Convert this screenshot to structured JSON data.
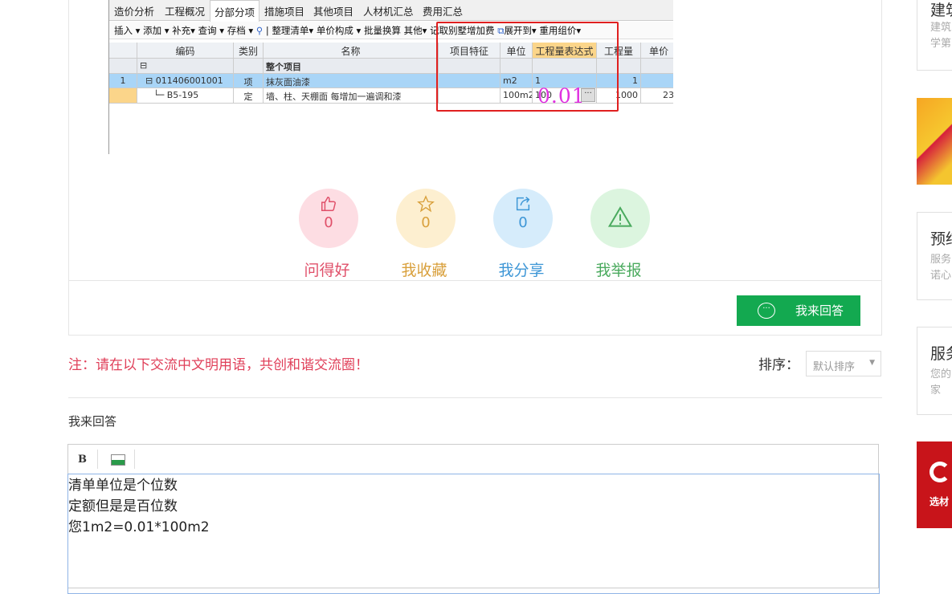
{
  "screenshot": {
    "tabs": [
      "造价分析",
      "工程概况",
      "分部分项",
      "措施项目",
      "其他项目",
      "人材机汇总",
      "费用汇总"
    ],
    "active_tab": "分部分项",
    "toolbar": [
      "插入 ▾",
      "添加 ▾",
      "补充▾",
      "查询 ▾",
      "存档 ▾",
      "整理清单▾",
      "单价构成 ▾",
      "批量换算",
      "其他▾",
      "记取别墅增加费",
      "展开到▾",
      "重用组价▾"
    ],
    "columns": [
      "编码",
      "类别",
      "名称",
      "项目特征",
      "单位",
      "工程量表达式",
      "工程量",
      "单价"
    ],
    "rows": [
      {
        "num": "",
        "code": "",
        "type": "",
        "name": "整个项目",
        "feature": "",
        "unit": "",
        "expr": "",
        "qty": "",
        "price": ""
      },
      {
        "num": "1",
        "code": "011406001001",
        "type": "项",
        "name": "抹灰面油漆",
        "feature": "",
        "unit": "m2",
        "expr": "1",
        "qty": "1",
        "price": ""
      },
      {
        "num": "",
        "code": "B5-195",
        "type": "定",
        "name": "墙、柱、天棚面 每增加一遍调和漆",
        "feature": "",
        "unit": "100m2",
        "expr": "100",
        "qty": "1000",
        "price": "23"
      }
    ],
    "annotation": "0.01"
  },
  "actions": [
    {
      "label": "问得好",
      "count": "0",
      "icon": "thumbs-up-icon",
      "color": "#e0506a",
      "bg": "#fddde3"
    },
    {
      "label": "我收藏",
      "count": "0",
      "icon": "star-icon",
      "color": "#d9a03c",
      "bg": "#fdefd0"
    },
    {
      "label": "我分享",
      "count": "0",
      "icon": "share-icon",
      "color": "#3d96d6",
      "bg": "#d6ecfb"
    },
    {
      "label": "我举报",
      "count": "",
      "icon": "warning-icon",
      "color": "#4aaa5e",
      "bg": "#dcf5df"
    }
  ],
  "answer_button": "我来回答",
  "notice": "注：请在以下交流中文明用语，共创和谐交流圈！",
  "sort": {
    "label": "排序：",
    "value": "默认排序"
  },
  "reply_title": "我来回答",
  "editor": {
    "bold": "B",
    "lines": [
      "清单单位是个位数",
      "定额但是是百位数",
      "您1m2=0.01*100m2"
    ]
  },
  "sidebar": [
    {
      "title": "建筑",
      "lines": [
        "建筑",
        "学第"
      ]
    },
    {
      "title": "预结",
      "lines": [
        "服务",
        "诺心"
      ]
    },
    {
      "title": "服务",
      "lines": [
        "您的",
        "家"
      ]
    },
    {
      "banner": "选材"
    }
  ]
}
